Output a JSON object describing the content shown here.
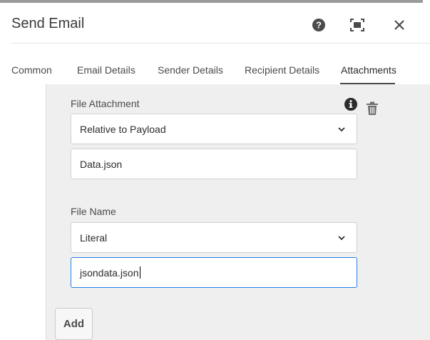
{
  "dialog": {
    "title": "Send Email",
    "icons": {
      "help": "help-icon",
      "fullscreen": "fullscreen-icon",
      "close": "close-icon"
    }
  },
  "tabs": [
    {
      "label": "Common",
      "active": false
    },
    {
      "label": "Email Details",
      "active": false
    },
    {
      "label": "Sender Details",
      "active": false
    },
    {
      "label": "Recipient Details",
      "active": false
    },
    {
      "label": "Attachments",
      "active": true
    }
  ],
  "attachments": {
    "file_attachment": {
      "label": "File Attachment",
      "select_value": "Relative to Payload",
      "input_value": "Data.json"
    },
    "file_name": {
      "label": "File Name",
      "select_value": "Literal",
      "input_value": "jsondata.json"
    },
    "add_label": "Add"
  },
  "colors": {
    "panel_background": "#efefef",
    "focus_border": "#2680eb",
    "active_tab_underline": "#4b4b4b"
  }
}
